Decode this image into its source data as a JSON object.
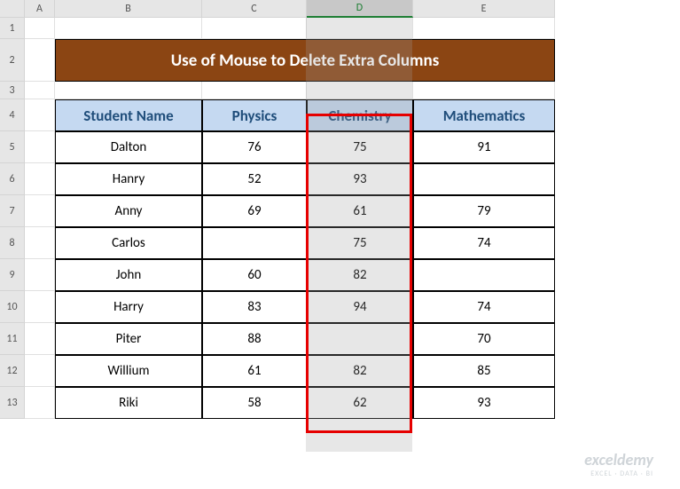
{
  "columns": [
    "A",
    "B",
    "C",
    "D",
    "E"
  ],
  "selected_column": "D",
  "rows": [
    "1",
    "2",
    "3",
    "4",
    "5",
    "6",
    "7",
    "8",
    "9",
    "10",
    "11",
    "12",
    "13"
  ],
  "title": "Use of Mouse to Delete Extra Columns",
  "headers": {
    "name": "Student Name",
    "physics": "Physics",
    "chemistry": "Chemistry",
    "math": "Mathematics"
  },
  "students": [
    {
      "name": "Dalton",
      "physics": "76",
      "chemistry": "75",
      "math": "91"
    },
    {
      "name": "Hanry",
      "physics": "52",
      "chemistry": "93",
      "math": ""
    },
    {
      "name": "Anny",
      "physics": "69",
      "chemistry": "61",
      "math": "79"
    },
    {
      "name": "Carlos",
      "physics": "",
      "chemistry": "75",
      "math": "74"
    },
    {
      "name": "John",
      "physics": "60",
      "chemistry": "82",
      "math": ""
    },
    {
      "name": "Harry",
      "physics": "83",
      "chemistry": "94",
      "math": "74"
    },
    {
      "name": "Piter",
      "physics": "88",
      "chemistry": "",
      "math": "70"
    },
    {
      "name": "Willium",
      "physics": "61",
      "chemistry": "82",
      "math": "85"
    },
    {
      "name": "Riki",
      "physics": "58",
      "chemistry": "62",
      "math": "93"
    }
  ],
  "watermark": {
    "brand": "exceldemy",
    "tag": "EXCEL · DATA · BI"
  },
  "chart_data": {
    "type": "table",
    "title": "Use of Mouse to Delete Extra Columns",
    "columns": [
      "Student Name",
      "Physics",
      "Chemistry",
      "Mathematics"
    ],
    "rows": [
      [
        "Dalton",
        76,
        75,
        91
      ],
      [
        "Hanry",
        52,
        93,
        null
      ],
      [
        "Anny",
        69,
        61,
        79
      ],
      [
        "Carlos",
        null,
        75,
        74
      ],
      [
        "John",
        60,
        82,
        null
      ],
      [
        "Harry",
        83,
        94,
        74
      ],
      [
        "Piter",
        88,
        null,
        70
      ],
      [
        "Willium",
        61,
        82,
        85
      ],
      [
        "Riki",
        58,
        62,
        93
      ]
    ]
  }
}
